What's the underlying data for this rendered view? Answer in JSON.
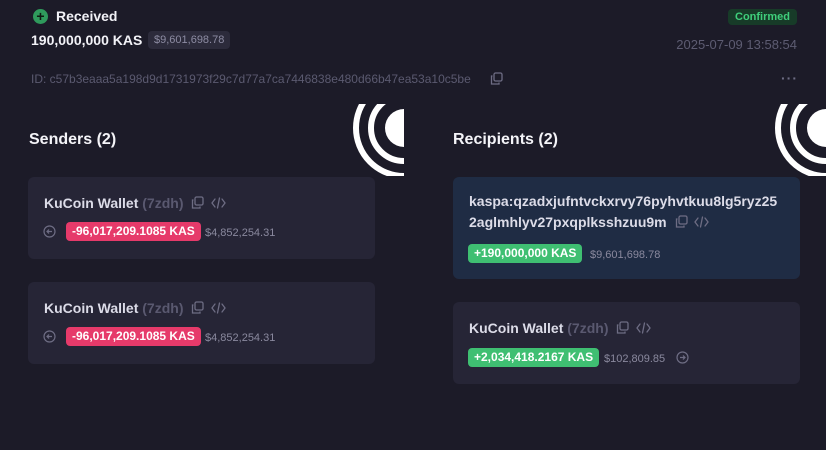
{
  "header": {
    "plus_icon": "plus-circle-icon",
    "status_label": "Received",
    "amount": "190,000,000 KAS",
    "amount_usd": "$9,601,698.78",
    "confirmation": "Confirmed",
    "timestamp": "2025-07-09 13:58:54",
    "tx_id": "ID: c57b3eaaa5a198d9d1731973f29c7d77a7ca7446838e480d66b47ea53a10c5be",
    "copy_icon": "copy-icon",
    "more_icon": "more-horizontal-icon",
    "more_glyph": "···"
  },
  "senders": {
    "title": "Senders (2)",
    "items": [
      {
        "wallet": "KuCoin Wallet",
        "tag": "(7zdh)",
        "amount": "-96,017,209.1085 KAS",
        "usd": "$4,852,254.31",
        "arrow_icon": "arrow-left-circle-icon"
      },
      {
        "wallet": "KuCoin Wallet",
        "tag": "(7zdh)",
        "amount": "-96,017,209.1085 KAS",
        "usd": "$4,852,254.31",
        "arrow_icon": "arrow-left-circle-icon"
      }
    ]
  },
  "recipients": {
    "title": "Recipients (2)",
    "items": [
      {
        "address_line1": "kaspa:qzadxjufntvckxrvy76pyhvtkuu8lg5ryz25",
        "address_line2": "2aglmhlyv27pxqplksshzuu9m",
        "amount": "+190,000,000 KAS",
        "usd": "$9,601,698.78"
      },
      {
        "wallet": "KuCoin Wallet",
        "tag": "(7zdh)",
        "amount": "+2,034,418.2167 KAS",
        "usd": "$102,809.85",
        "arrow_icon": "arrow-right-circle-icon"
      }
    ]
  },
  "colors": {
    "background": "#1c1b28",
    "card": "#262536",
    "card_highlight": "#1f2c44",
    "negative": "#e63a6a",
    "positive": "#3fbf72",
    "confirmed": "#3fcf7b"
  }
}
